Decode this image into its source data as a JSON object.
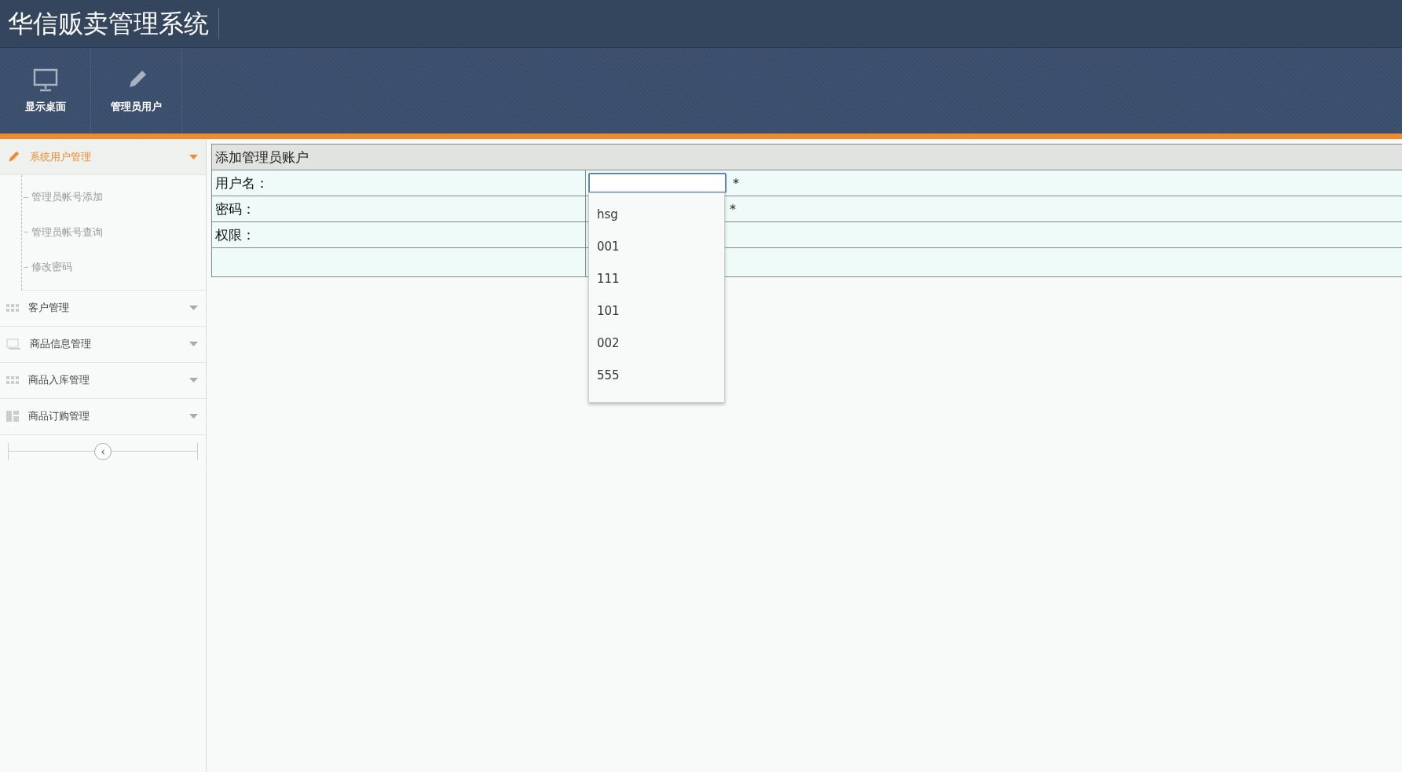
{
  "app_title": "华信贩卖管理系统",
  "toolbar": [
    {
      "label": "显示桌面",
      "kind": "monitor"
    },
    {
      "label": "管理员用户",
      "kind": "pencil"
    }
  ],
  "sidebar": {
    "sections": [
      {
        "label": "系统用户管理",
        "kind": "pencil",
        "expanded": true,
        "children": [
          {
            "label": "管理员帐号添加"
          },
          {
            "label": "管理员帐号查询"
          },
          {
            "label": "修改密码"
          }
        ]
      },
      {
        "label": "客户管理",
        "kind": "grid",
        "expanded": false
      },
      {
        "label": "商品信息管理",
        "kind": "image",
        "expanded": false
      },
      {
        "label": "商品入库管理",
        "kind": "grid",
        "expanded": false
      },
      {
        "label": "商品订购管理",
        "kind": "layout",
        "expanded": false
      }
    ],
    "collapse": "‹"
  },
  "form": {
    "title": "添加管理员账户",
    "rows": [
      {
        "label": "用户名：",
        "kind": "input",
        "required": "*"
      },
      {
        "label": "密码：",
        "kind": "blank",
        "required": "*"
      },
      {
        "label": "权限：",
        "kind": "blank"
      },
      {
        "kind": "empty"
      }
    ]
  },
  "autocomplete": [
    "hsg",
    "001",
    "111",
    "101",
    "002",
    "555"
  ]
}
